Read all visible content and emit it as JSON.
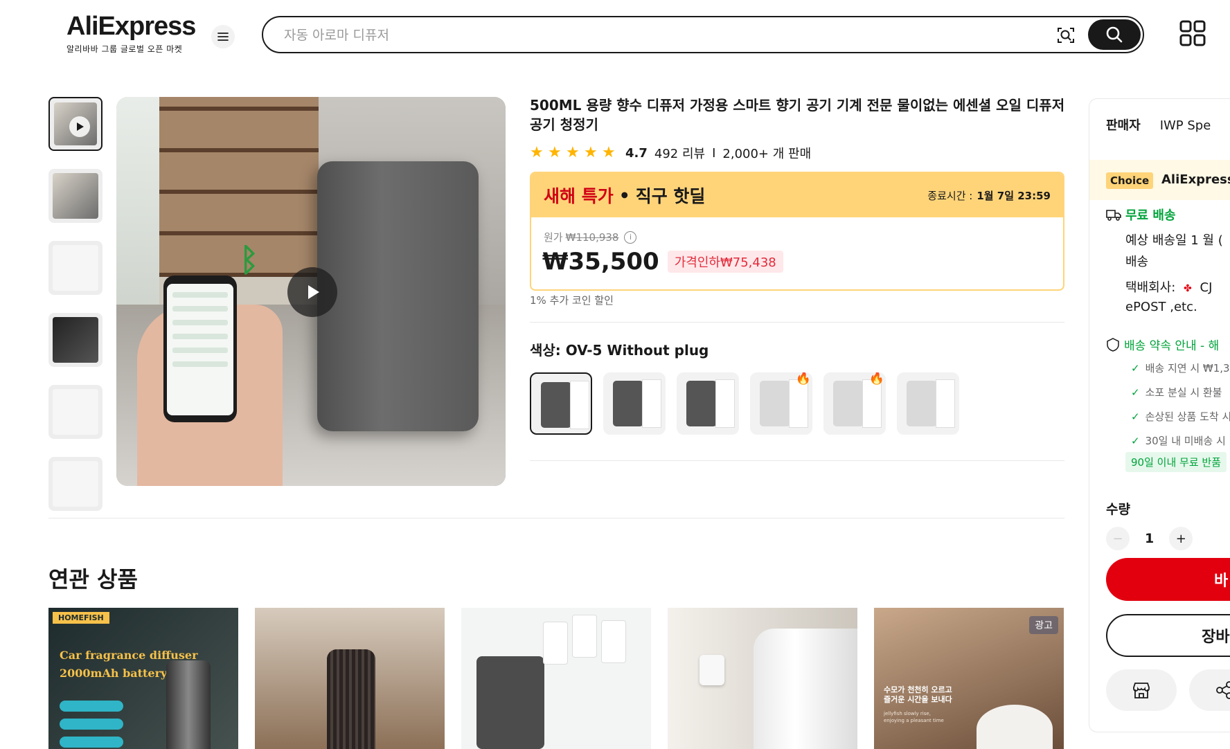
{
  "header": {
    "logo": "AliExpress",
    "logo_sub": "알리바바 그룹 글로벌 오픈 마켓",
    "search_placeholder": "자동 아로마 디퓨저",
    "icons": [
      "menu-icon",
      "camera-search-icon",
      "search-icon",
      "qr-code-icon"
    ]
  },
  "gallery": {
    "thumbnail_count": 6,
    "active_thumbnail": 1,
    "main_media": "video"
  },
  "product": {
    "title": "500ML 용량 향수 디퓨저 가정용 스마트 향기 공기 기계 전문 물이없는 에센셜 오일 디퓨저 공기 청정기",
    "rating": "4.7",
    "reviews": "492 리뷰",
    "separator": "I",
    "sold": "2,000+ 개 판매",
    "stars": 5,
    "deal": {
      "label_red": "새해 특가",
      "dot": "•",
      "label_black": "직구 핫딜",
      "end_label": "종료시간 :",
      "end_time": "1월 7일 23:59"
    },
    "original_label": "원가",
    "original_price": "₩110,938",
    "price": "₩35,500",
    "discount": "가격인하₩75,438",
    "coin_note": "1% 추가 코인 할인",
    "color_label": "색상: OV-5 Without plug",
    "variants": [
      {
        "tone": "dark",
        "selected": true,
        "hot": false
      },
      {
        "tone": "dark",
        "selected": false,
        "hot": false
      },
      {
        "tone": "dark",
        "selected": false,
        "hot": false
      },
      {
        "tone": "light",
        "selected": false,
        "hot": true
      },
      {
        "tone": "light",
        "selected": false,
        "hot": true
      },
      {
        "tone": "light",
        "selected": false,
        "hot": false
      }
    ]
  },
  "related": {
    "title": "연관 상품",
    "cards": [
      {
        "brand": "HOMEFISH",
        "text_line1": "Car fragrance diffuser",
        "text_line2": "2000mAh battery"
      },
      {},
      {},
      {},
      {
        "ad": "광고",
        "text_line1": "수모가 천천히 오르고",
        "text_line2": "즐거운 시간을 보내다",
        "sub_line1": "jellyfish slowly rise,",
        "sub_line2": "enjoying a pleasant time"
      }
    ]
  },
  "side": {
    "seller_label": "판매자",
    "seller_name": "IWP Spe",
    "choice_tag": "Choice",
    "choice_name": "AliExpress",
    "shipping_title": "무료 배송",
    "eta_line1": "예상 배송일 1 월 (",
    "eta_line2": "배송",
    "courier_line1": "택배회사:",
    "courier_name": "CJ",
    "courier_line2": "ePOST ,etc.",
    "promise_title": "배송 약속 안내 - 해",
    "checks": [
      "배송 지연 시 ₩1,3",
      "소포 분실 시 환불",
      "손상된 상품 도착 시",
      "30일 내 미배송 시"
    ],
    "return_badge": "90일 이내 무료 반품",
    "qty_label": "수량",
    "qty_value": "1",
    "buy_label": "바",
    "cart_label": "장바",
    "accent": "#e2000f",
    "green": "#00a33a"
  }
}
